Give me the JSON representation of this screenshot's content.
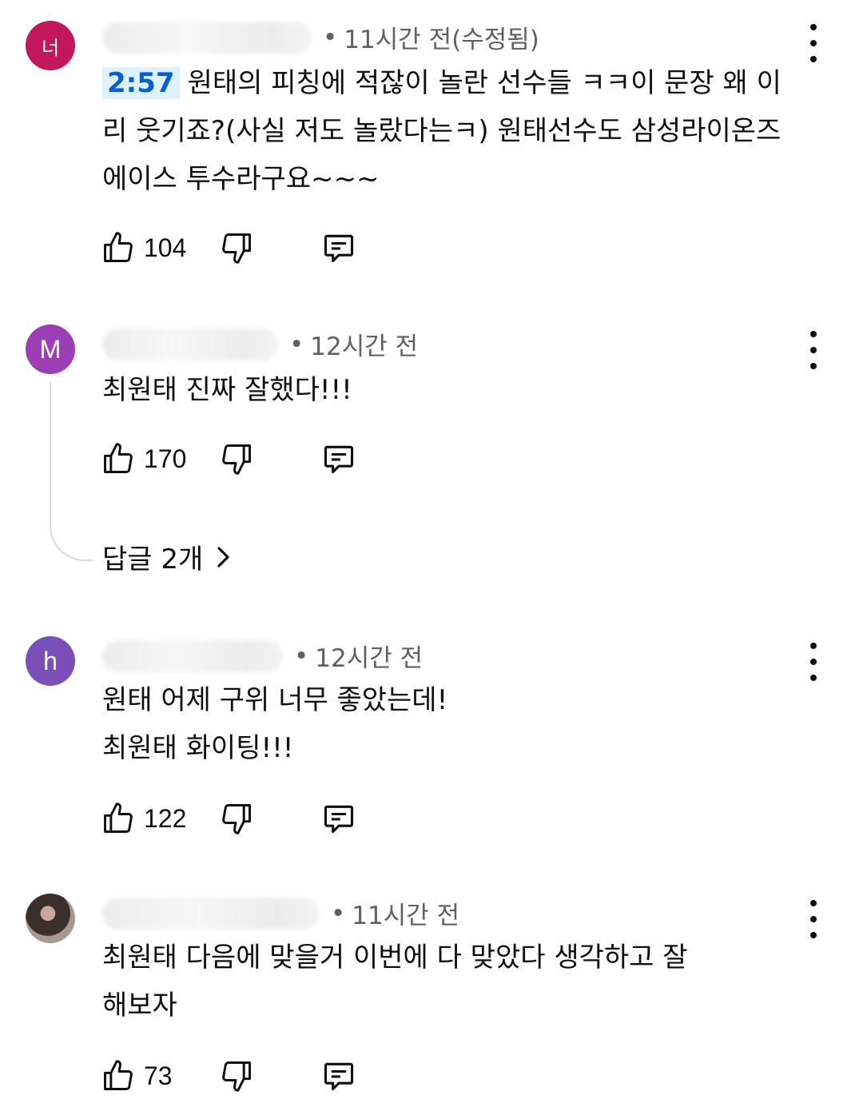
{
  "comments": [
    {
      "avatar_letter": "너",
      "avatar_color": "#c2185b",
      "time": "11시간 전(수정됨)",
      "timestamp_link": "2:57",
      "text": "원태의 피칭에 적잖이 놀란 선수들 ㅋㅋ이 문장 왜 이리 웃기죠?(사실 저도 놀랐다는ㅋ) 원태선수도 삼성라이온즈 에이스 투수라구요~~~",
      "likes": "104"
    },
    {
      "avatar_letter": "M",
      "avatar_color": "#9c3fb6",
      "time": "12시간 전",
      "text": "최원태 진짜 잘했다!!!",
      "likes": "170",
      "replies_label": "답글 2개"
    },
    {
      "avatar_letter": "h",
      "avatar_color": "#7b4fb8",
      "time": "12시간 전",
      "text": "원태 어제 구위 너무 좋았는데!\n최원태 화이팅!!!",
      "likes": "122"
    },
    {
      "avatar_letter": "",
      "avatar_color": "#5a4a45",
      "time": "11시간 전",
      "text": "최원태 다음에 맞을거 이번에 다 맞았다 생각하고 잘해보자",
      "likes": "73"
    }
  ],
  "meta_separator": "•",
  "icons": {
    "like": "thumbs-up-icon",
    "dislike": "thumbs-down-icon",
    "reply": "comment-icon",
    "more": "more-vert-icon",
    "chevron": "chevron-right-icon"
  }
}
